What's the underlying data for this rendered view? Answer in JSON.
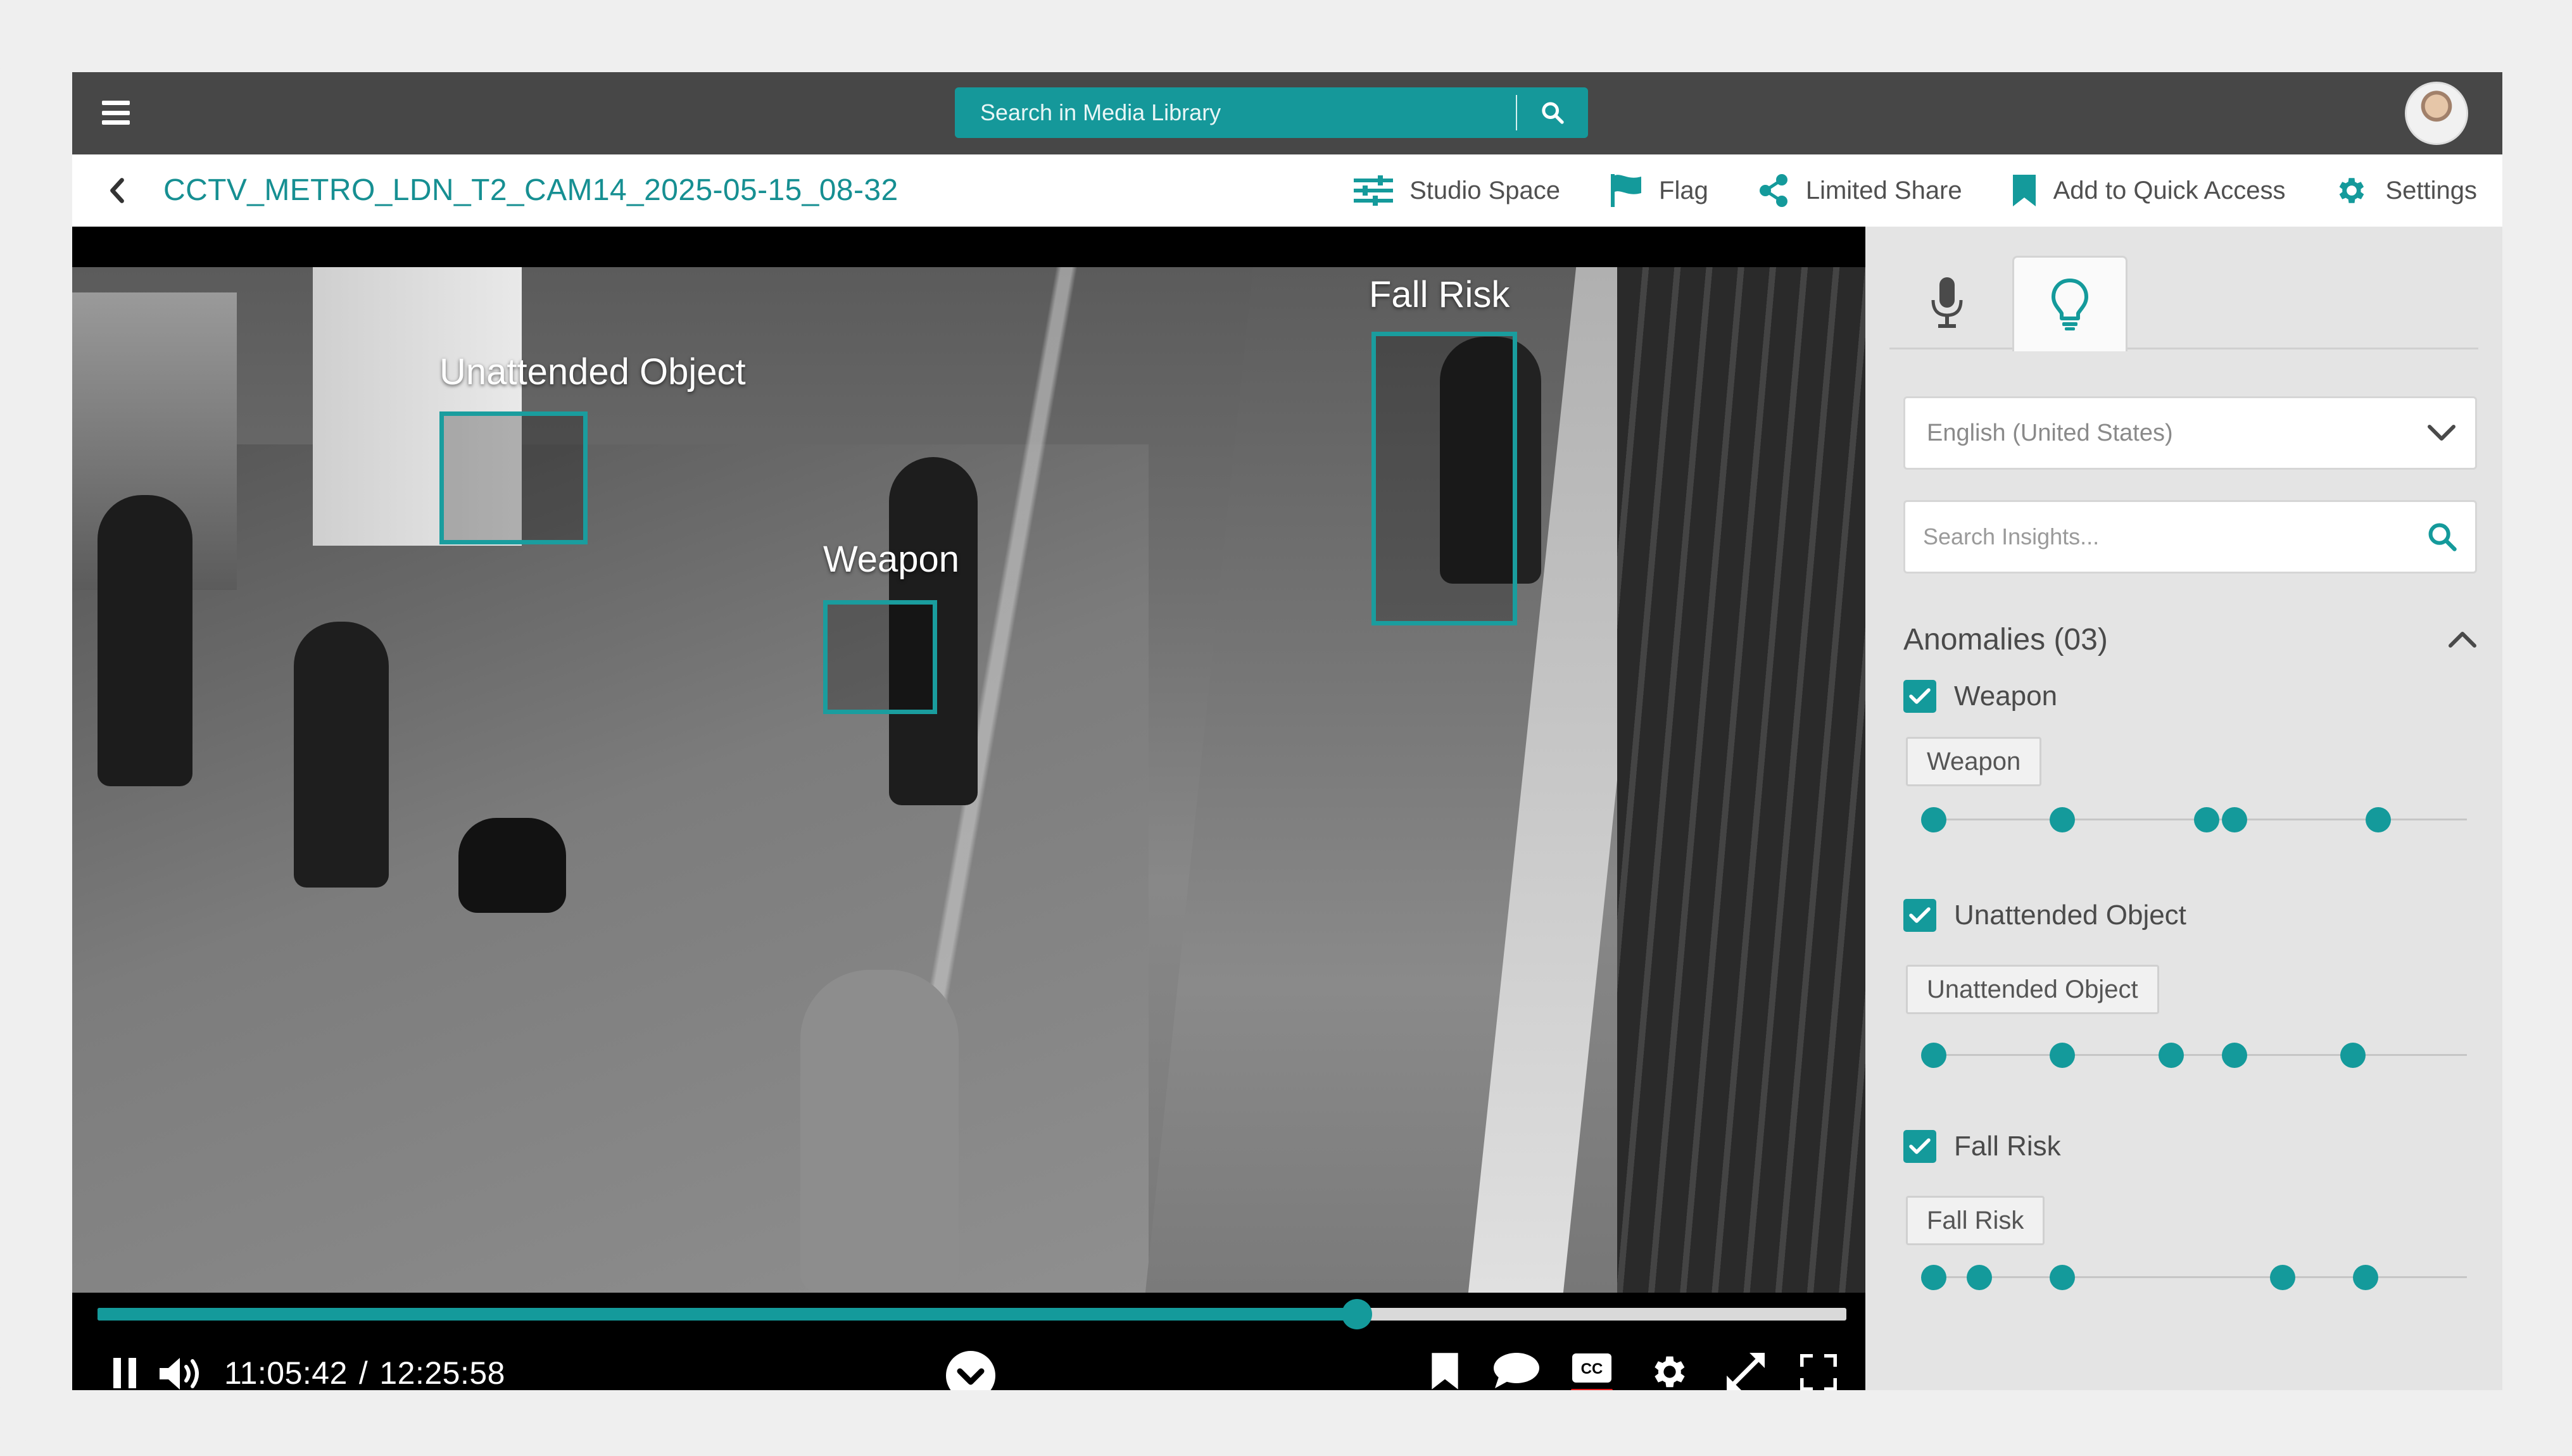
{
  "topbar": {
    "search_placeholder": "Search in Media Library",
    "menu_icon": "hamburger-icon",
    "search_icon": "search-icon",
    "avatar_icon": "user-avatar"
  },
  "titlebar": {
    "title": "CCTV_METRO_LDN_T2_CAM14_2025-05-15_08-32",
    "actions": {
      "studio": "Studio Space",
      "flag": "Flag",
      "share": "Limited Share",
      "quick": "Add to Quick Access",
      "settings": "Settings"
    }
  },
  "video": {
    "detections": {
      "unattended": "Unattended Object",
      "weapon": "Weapon",
      "fall": "Fall Risk"
    },
    "progress": 0.72,
    "current_time": "11:05:42",
    "separator": "/",
    "total_time": "12:25:58"
  },
  "panel": {
    "tabs": [
      "microphone-icon",
      "lightbulb-icon"
    ],
    "language": "English (United States)",
    "search_placeholder": "Search Insights...",
    "anomalies_title": "Anomalies (03)",
    "categories": [
      {
        "name": "Weapon",
        "chip": "Weapon",
        "markers": [
          0.0,
          0.254,
          0.539,
          0.594,
          0.877
        ]
      },
      {
        "name": "Unattended Object",
        "chip": "Unattended Object",
        "markers": [
          0.0,
          0.254,
          0.469,
          0.594,
          0.828
        ]
      },
      {
        "name": "Fall Risk",
        "chip": "Fall Risk",
        "markers": [
          0.0,
          0.09,
          0.254,
          0.689,
          0.852
        ]
      }
    ]
  },
  "colors": {
    "accent": "#149a9b",
    "title_text": "#168f92",
    "topbar": "#474747",
    "panel_bg": "#e4e4e4"
  }
}
